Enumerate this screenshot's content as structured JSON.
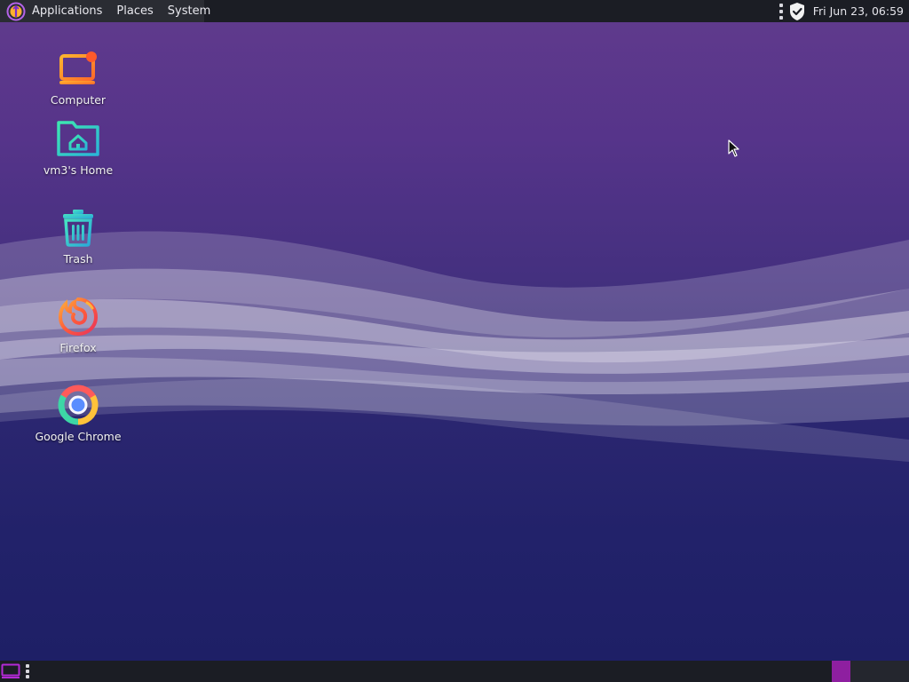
{
  "top_panel": {
    "menu": {
      "applications": "Applications",
      "places": "Places",
      "system": "System"
    },
    "tray": {
      "clock": "Fri Jun 23, 06:59",
      "icons": [
        "more-dots-icon",
        "shield-check-icon"
      ]
    }
  },
  "desktop": {
    "icons": [
      {
        "label": "Computer",
        "icon": "computer-icon"
      },
      {
        "label": "vm3's Home",
        "icon": "home-folder-icon"
      },
      {
        "label": "Trash",
        "icon": "trash-icon"
      },
      {
        "label": "Firefox",
        "icon": "firefox-icon"
      },
      {
        "label": "Google Chrome",
        "icon": "chrome-icon"
      }
    ]
  },
  "bottom_panel": {
    "icons": [
      "show-desktop-icon",
      "more-dots-icon"
    ],
    "workspaces": 2,
    "active_workspace": 1
  },
  "colors": {
    "panel": "#1b1d24",
    "menu_group": "#2a2c33",
    "accent": "#8e1fa0",
    "desktop_top": "#5f3a8c",
    "desktop_bottom": "#1e1f66"
  }
}
